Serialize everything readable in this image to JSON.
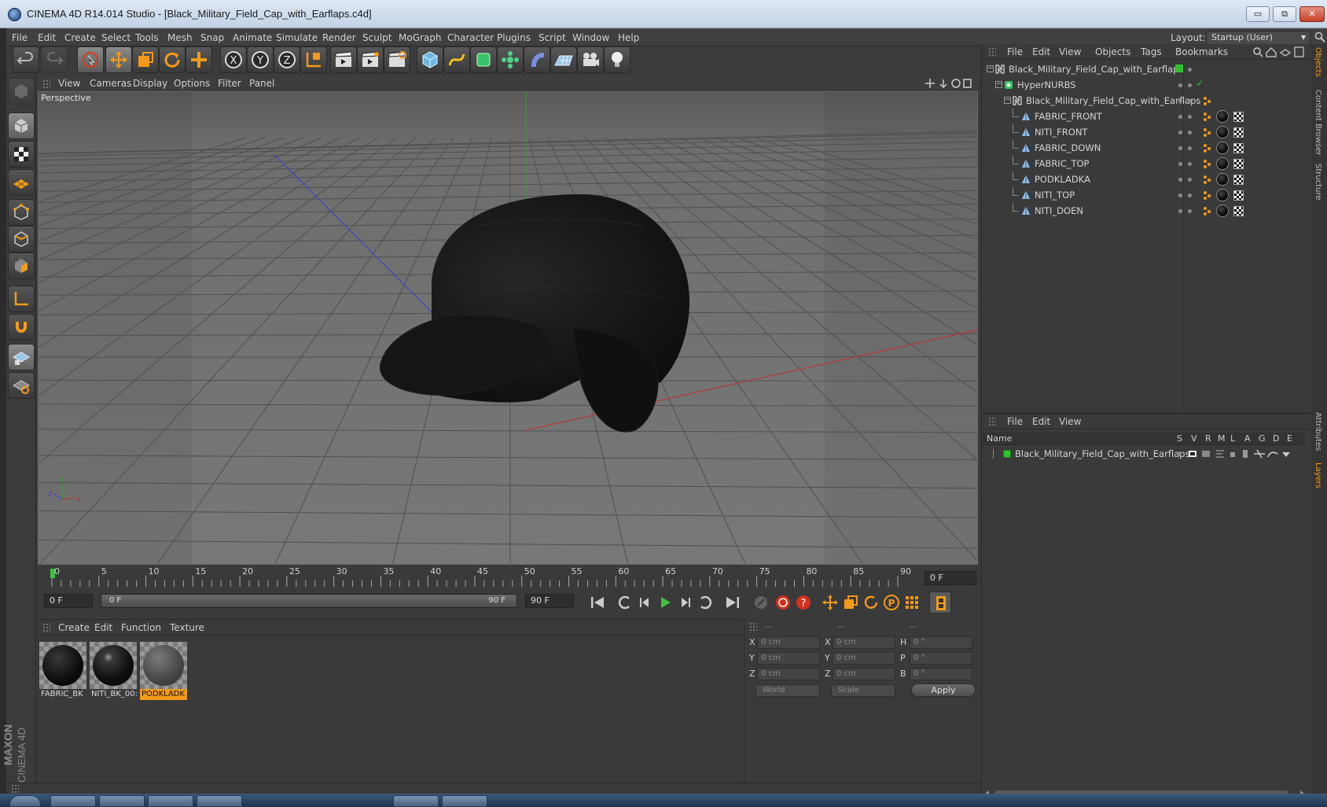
{
  "window": {
    "title": "CINEMA 4D R14.014 Studio - [Black_Military_Field_Cap_with_Earflaps.c4d]",
    "minimize": "▭",
    "restore": "⧉",
    "close": "✕"
  },
  "menubar": {
    "items": [
      "File",
      "Edit",
      "Create",
      "Select",
      "Tools",
      "Mesh",
      "Snap",
      "Animate",
      "Simulate",
      "Render",
      "Sculpt",
      "MoGraph",
      "Character",
      "Plugins",
      "Script",
      "Window",
      "Help"
    ],
    "layout_label": "Layout:",
    "layout_value": "Startup (User)"
  },
  "viewport": {
    "menu": [
      "View",
      "Cameras",
      "Display",
      "Options",
      "Filter",
      "Panel"
    ],
    "label": "Perspective",
    "axis_x": "X",
    "axis_y": "Y",
    "axis_z": "Z"
  },
  "timeline": {
    "ticks": [
      "0",
      "5",
      "10",
      "15",
      "20",
      "25",
      "30",
      "35",
      "40",
      "45",
      "50",
      "55",
      "60",
      "65",
      "70",
      "75",
      "80",
      "85",
      "90"
    ],
    "current_frame": "0 F",
    "start_field": "0 F",
    "range_start": "0 F",
    "range_end": "90 F",
    "end_field": "90 F",
    "playhead_fraction": 0
  },
  "materials": {
    "menu": [
      "Create",
      "Edit",
      "Function",
      "Texture"
    ],
    "items": [
      {
        "label": "FABRIC_BK",
        "selected": false,
        "color": "#0c0c0c"
      },
      {
        "label": "NITI_BK_00:",
        "selected": false,
        "color": "#1a1a1a"
      },
      {
        "label": "PODKLADK",
        "selected": true,
        "color": "#4a4a4a"
      }
    ]
  },
  "coordinates": {
    "header": [
      "--",
      "--",
      "--"
    ],
    "rows": [
      {
        "a": "X",
        "av": "0 cm",
        "b": "X",
        "bv": "0 cm",
        "c": "H",
        "cv": "0 °"
      },
      {
        "a": "Y",
        "av": "0 cm",
        "b": "Y",
        "bv": "0 cm",
        "c": "P",
        "cv": "0 °"
      },
      {
        "a": "Z",
        "av": "0 cm",
        "b": "Z",
        "bv": "0 cm",
        "c": "B",
        "cv": "0 °"
      }
    ],
    "world": "World",
    "scale": "Scale",
    "apply": "Apply"
  },
  "objects": {
    "menu": [
      "File",
      "Edit",
      "View",
      "Objects",
      "Tags",
      "Bookmarks"
    ],
    "tree": [
      {
        "name": "Black_Military_Field_Cap_with_Earflaps",
        "depth": 0,
        "type": "null"
      },
      {
        "name": "HyperNURBS",
        "depth": 1,
        "type": "nurbs"
      },
      {
        "name": "Black_Military_Field_Cap_with_Earflaps",
        "depth": 2,
        "type": "null"
      },
      {
        "name": "FABRIC_FRONT",
        "depth": 3,
        "type": "poly"
      },
      {
        "name": "NITI_FRONT",
        "depth": 3,
        "type": "poly"
      },
      {
        "name": "FABRIC_DOWN",
        "depth": 3,
        "type": "poly"
      },
      {
        "name": "FABRIC_TOP",
        "depth": 3,
        "type": "poly"
      },
      {
        "name": "PODKLADKA",
        "depth": 3,
        "type": "poly"
      },
      {
        "name": "NITI_TOP",
        "depth": 3,
        "type": "poly"
      },
      {
        "name": "NITI_DOEN",
        "depth": 3,
        "type": "poly"
      }
    ]
  },
  "layers": {
    "menu": [
      "File",
      "Edit",
      "View"
    ],
    "columns": [
      "Name",
      "S",
      "V",
      "R",
      "M",
      "L",
      "A",
      "G",
      "D",
      "E"
    ],
    "rows": [
      {
        "name": "Black_Military_Field_Cap_with_Earflaps",
        "color": "#2fc22f"
      }
    ]
  },
  "sidetabs": [
    "Objects",
    "Content Browser",
    "Structure",
    "Attributes",
    "Layers"
  ],
  "brand": {
    "maxon": "MAXON",
    "c4d": "CINEMA 4D"
  },
  "colors": {
    "accent": "#f39a1a",
    "layer_green": "#2fc22f"
  }
}
